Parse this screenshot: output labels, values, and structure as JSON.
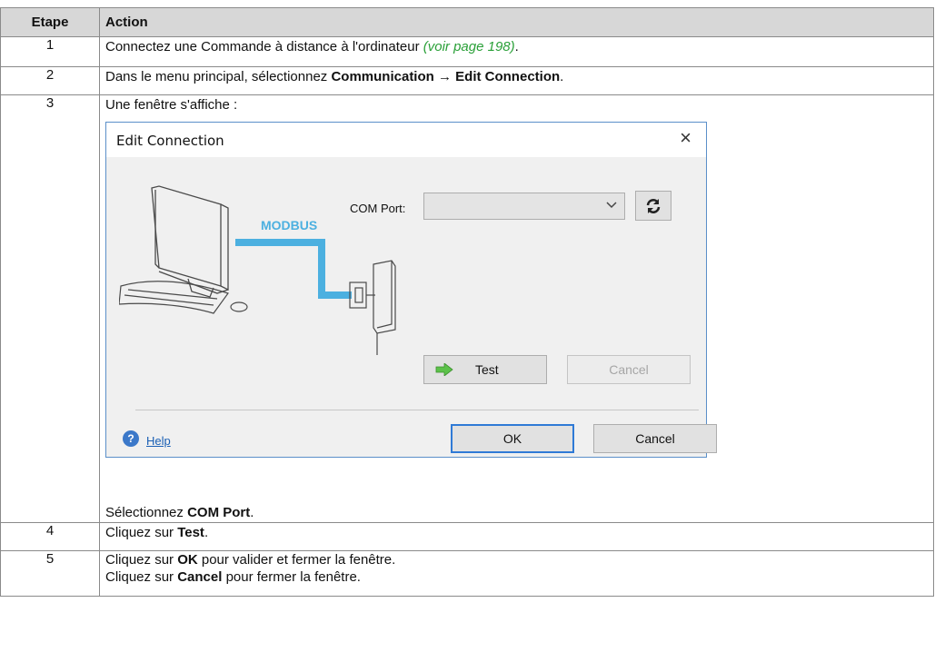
{
  "table": {
    "headers": {
      "step": "Etape",
      "action": "Action"
    },
    "rows": [
      {
        "num": "1",
        "text": "Connectez une Commande à distance à l'ordinateur ",
        "link": "(voir page 198)",
        "suffix": "."
      },
      {
        "num": "2",
        "pre": "Dans le menu principal, sélectionnez ",
        "bold1": "Communication",
        "arrow": " → ",
        "bold2": "Edit Connection",
        "suffix": "."
      },
      {
        "num": "3",
        "intro": "Une fenêtre s'affiche :",
        "outro_pre": "Sélectionnez ",
        "outro_bold": "COM Port",
        "outro_suffix": "."
      },
      {
        "num": "4",
        "pre": "Cliquez sur ",
        "bold": "Test",
        "suffix": "."
      },
      {
        "num": "5",
        "line1_pre": "Cliquez sur ",
        "line1_bold": "OK",
        "line1_post": " pour valider et fermer la fenêtre.",
        "line2_pre": "Cliquez sur ",
        "line2_bold": "Cancel",
        "line2_post": " pour fermer la fenêtre."
      }
    ]
  },
  "dialog": {
    "title": "Edit Connection",
    "close_icon": "×",
    "modbus_label": "MODBUS",
    "com_port_label": "COM Port:",
    "com_port_value": "",
    "refresh_icon": "refresh-icon",
    "test_button": "Test",
    "cancel_disabled_button": "Cancel",
    "help_link": "Help",
    "ok_button": "OK",
    "cancel_button": "Cancel",
    "accent_color": "#2f7ad6",
    "modbus_color": "#4cb0e0"
  }
}
